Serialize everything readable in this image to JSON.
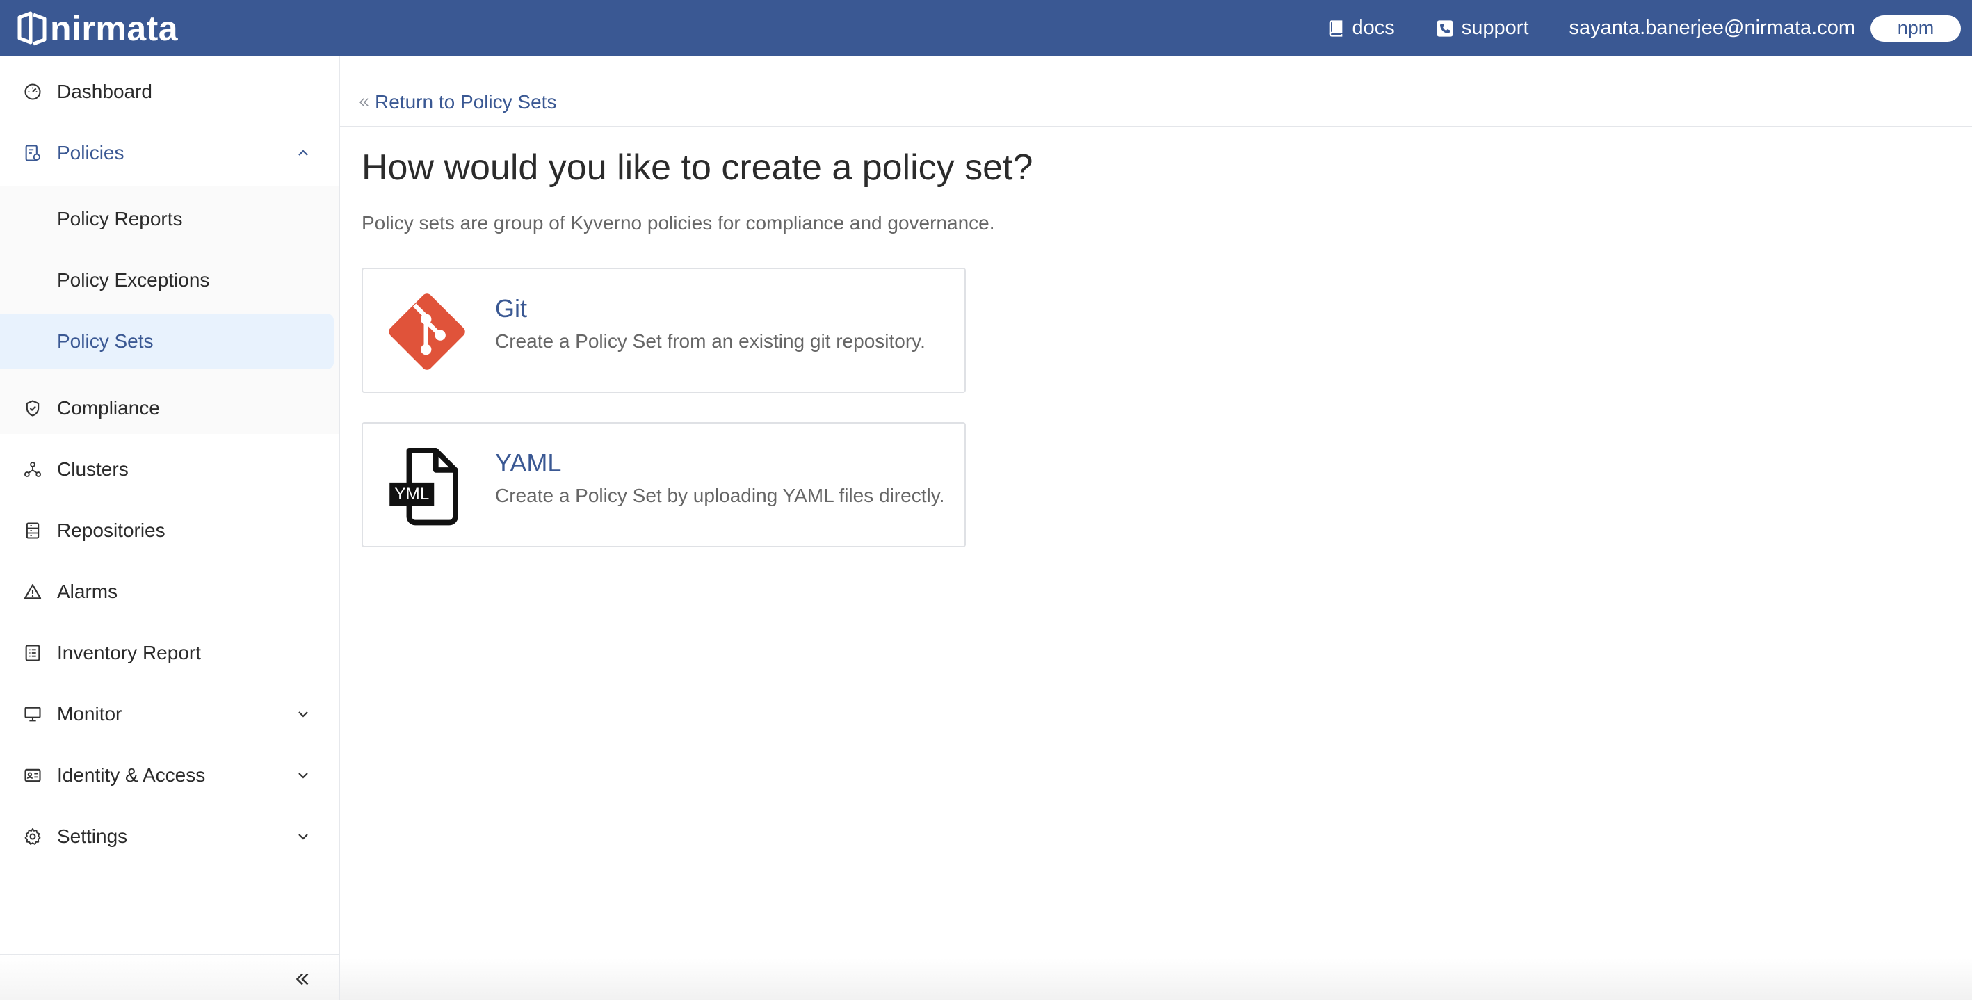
{
  "app": {
    "brand": "nirmata",
    "accent_color": "#3a5893"
  },
  "header": {
    "docs_label": "docs",
    "support_label": "support",
    "user_email": "sayanta.banerjee@nirmata.com",
    "org_label": "npm"
  },
  "sidebar": {
    "items": [
      {
        "label": "Dashboard",
        "icon": "gauge-icon"
      },
      {
        "label": "Policies",
        "icon": "policy-document-icon",
        "expanded": true
      },
      {
        "label": "Compliance",
        "icon": "shield-check-icon"
      },
      {
        "label": "Clusters",
        "icon": "cluster-nodes-icon"
      },
      {
        "label": "Repositories",
        "icon": "repository-icon"
      },
      {
        "label": "Alarms",
        "icon": "warning-triangle-icon"
      },
      {
        "label": "Inventory Report",
        "icon": "list-report-icon"
      },
      {
        "label": "Monitor",
        "icon": "monitor-icon",
        "expandable": true
      },
      {
        "label": "Identity & Access",
        "icon": "id-card-icon",
        "expandable": true
      },
      {
        "label": "Settings",
        "icon": "gear-icon",
        "expandable": true
      }
    ],
    "policies_subitems": [
      {
        "label": "Policy Reports"
      },
      {
        "label": "Policy Exceptions"
      },
      {
        "label": "Policy Sets",
        "selected": true
      }
    ]
  },
  "main": {
    "back_link": "Return to Policy Sets",
    "title": "How would you like to create a policy set?",
    "subtitle": "Policy sets are group of Kyverno policies for compliance and governance.",
    "options": [
      {
        "title": "Git",
        "description": "Create a Policy Set from an existing git repository.",
        "icon": "git-logo-icon",
        "icon_color": "#e0533a"
      },
      {
        "title": "YAML",
        "description": "Create a Policy Set by uploading YAML files directly.",
        "icon": "yaml-file-icon",
        "icon_badge": "YML"
      }
    ]
  }
}
